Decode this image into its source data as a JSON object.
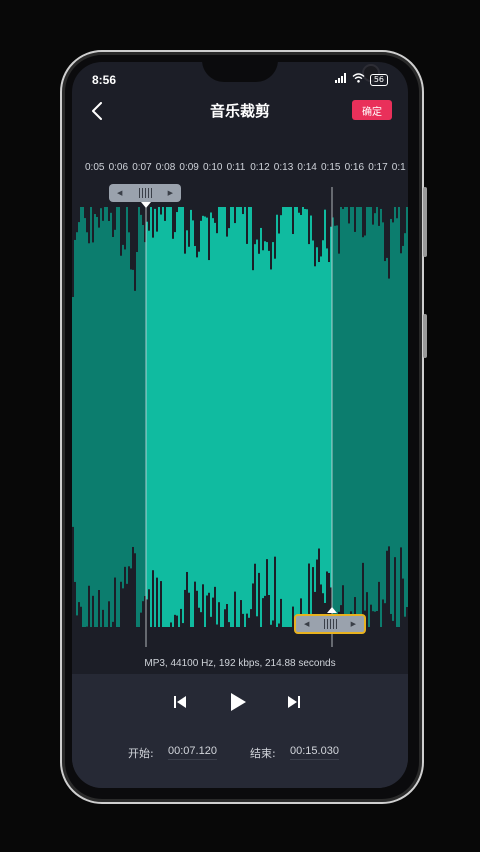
{
  "status": {
    "time": "8:56",
    "battery": "56"
  },
  "header": {
    "title": "音乐裁剪",
    "confirm_label": "确定"
  },
  "timeline": {
    "ticks": [
      "0:05",
      "0:06",
      "0:07",
      "0:08",
      "0:09",
      "0:10",
      "0:11",
      "0:12",
      "0:13",
      "0:14",
      "0:15",
      "0:16",
      "0:17",
      "0:1"
    ]
  },
  "audio_info": "MP3, 44100 Hz, 192 kbps, 214.88 seconds",
  "selection": {
    "start_label": "开始:",
    "start_value": "00:07.120",
    "end_label": "结束:",
    "end_value": "00:15.030"
  },
  "colors": {
    "wave_selected": "#10bba0",
    "wave_unselected": "#0c7d6e",
    "accent": "#e9305a",
    "handle_active": "#e8b21f",
    "background": "#1c1e27"
  }
}
